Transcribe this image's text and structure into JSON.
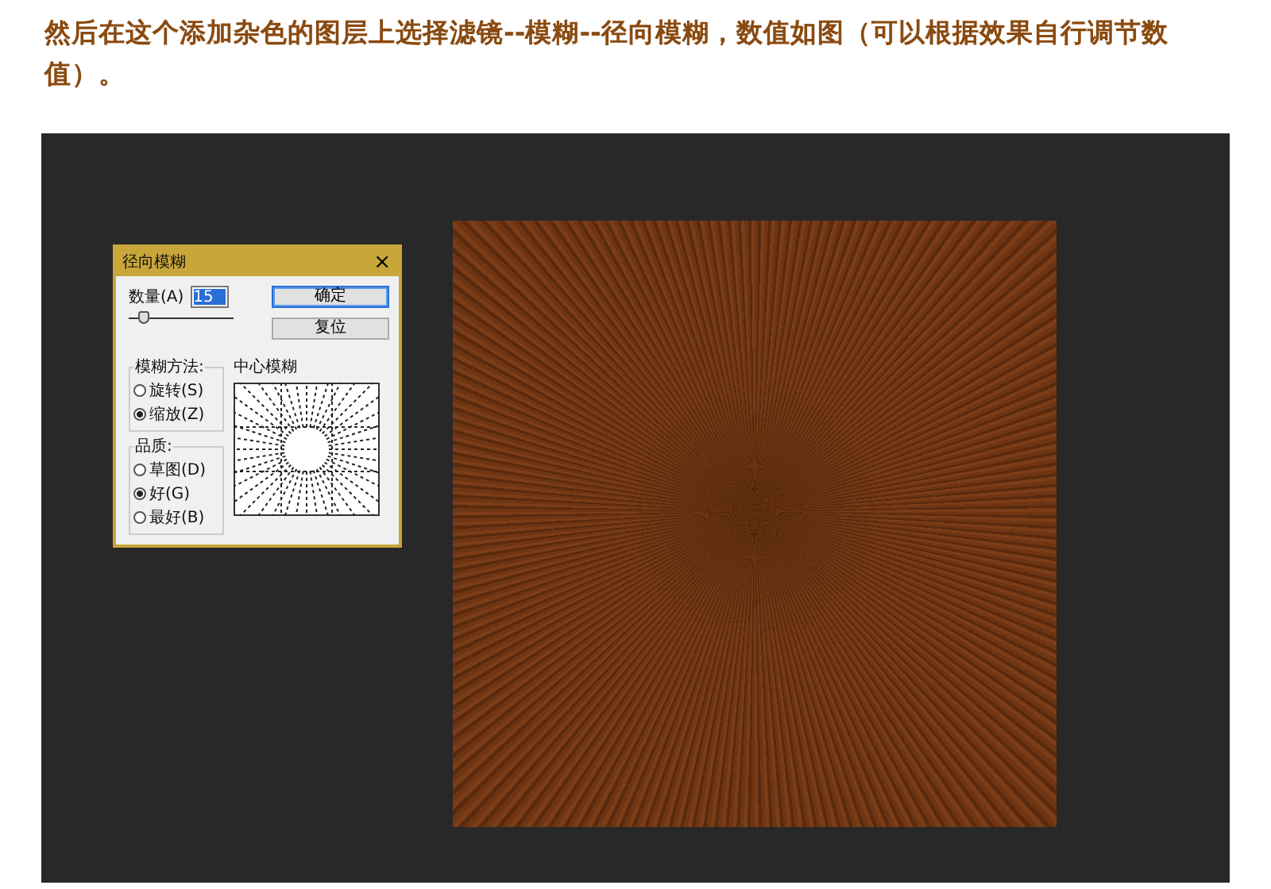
{
  "instruction": "然后在这个添加杂色的图层上选择滤镜--模糊--径向模糊，数值如图（可以根据效果自行调节数值）。",
  "dialog": {
    "title": "径向模糊",
    "close": "×",
    "amount": {
      "label": "数量(A)",
      "value": "15",
      "level": 0.15
    },
    "buttons": [
      {
        "label": "确定",
        "default": true
      },
      {
        "label": "复位",
        "default": false
      }
    ],
    "method": {
      "label": "模糊方法:",
      "options": [
        {
          "label": "旋转(S)",
          "selected": false
        },
        {
          "label": "缩放(Z)",
          "selected": true
        }
      ]
    },
    "quality": {
      "label": "品质:",
      "options": [
        {
          "label": "草图(D)",
          "selected": false
        },
        {
          "label": "好(G)",
          "selected": true
        },
        {
          "label": "最好(B)",
          "selected": false
        }
      ]
    },
    "center": {
      "label": "中心模糊"
    }
  }
}
